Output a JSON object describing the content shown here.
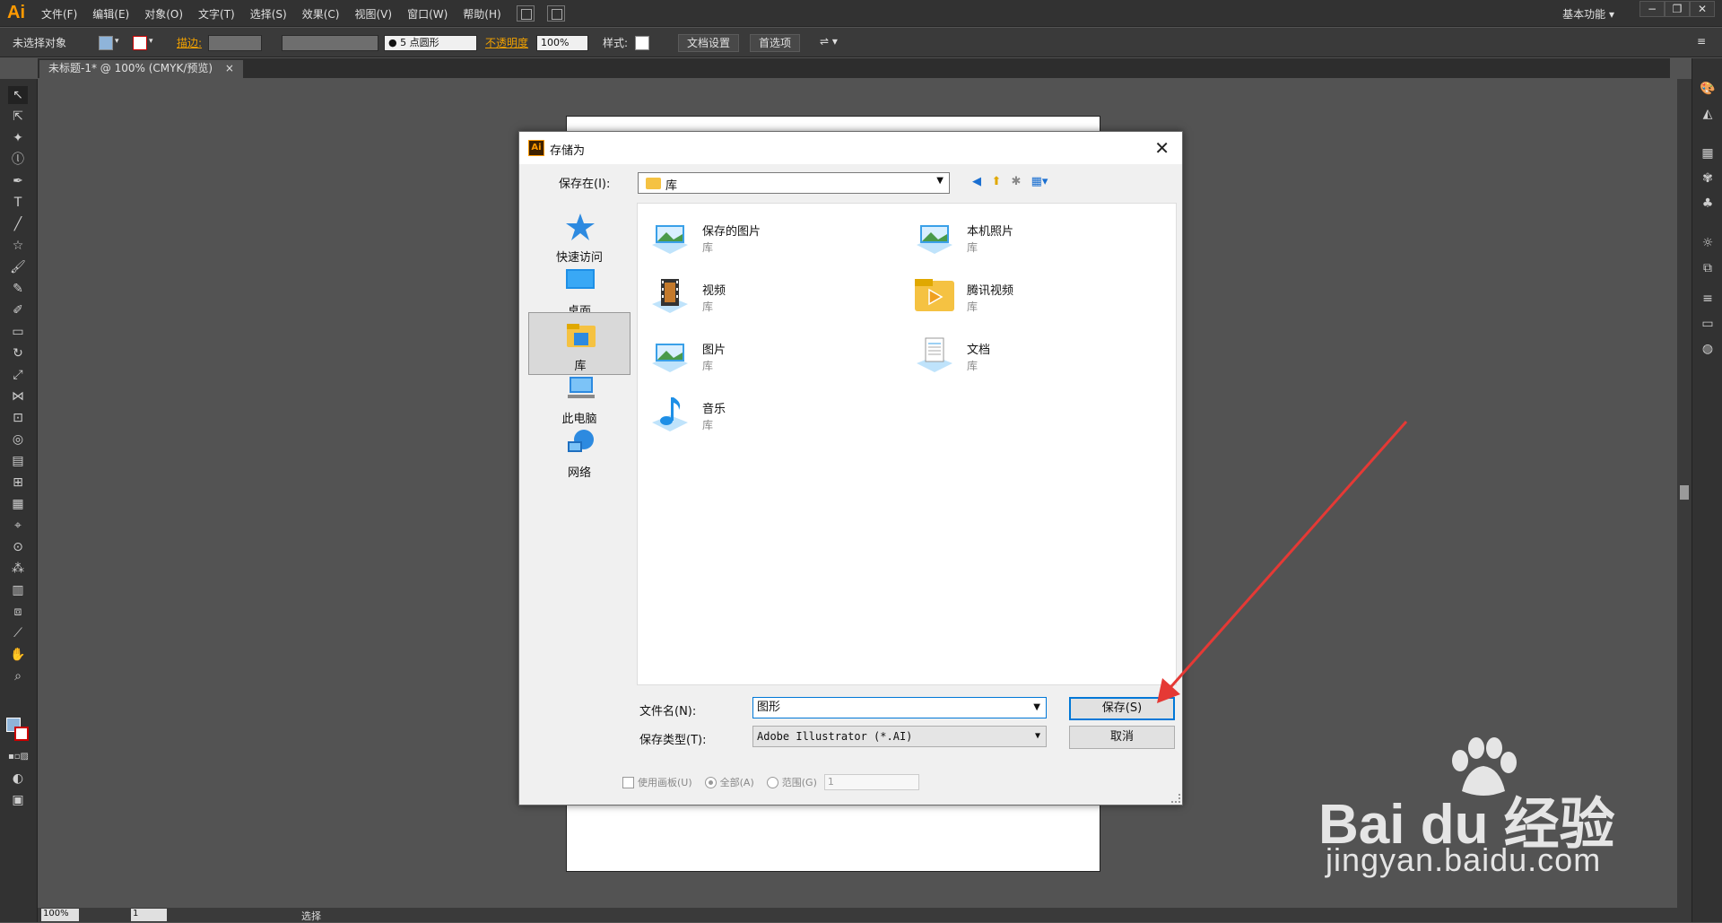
{
  "app": {
    "logo": "Ai",
    "workspace": "基本功能"
  },
  "menu": [
    "文件(F)",
    "编辑(E)",
    "对象(O)",
    "文字(T)",
    "选择(S)",
    "效果(C)",
    "视图(V)",
    "窗口(W)",
    "帮助(H)"
  ],
  "control_bar": {
    "selection": "未选择对象",
    "stroke_label": "描边:",
    "brush": "● 5 点圆形",
    "opacity_label": "不透明度",
    "opacity_value": "100%",
    "style_label": "样式:",
    "doc_setup": "文档设置",
    "prefs": "首选项"
  },
  "doc_tab": {
    "title": "未标题-1* @ 100% (CMYK/预览)",
    "close": "×"
  },
  "status": {
    "zoom": "100%",
    "page": "1",
    "mode": "选择"
  },
  "dialog": {
    "title": "存储为",
    "save_in_label": "保存在(I):",
    "save_in_value": "库",
    "places": [
      {
        "label": "快速访问",
        "icon": "star-icon"
      },
      {
        "label": "桌面",
        "icon": "desktop-icon"
      },
      {
        "label": "库",
        "icon": "library-icon",
        "selected": true
      },
      {
        "label": "此电脑",
        "icon": "computer-icon"
      },
      {
        "label": "网络",
        "icon": "network-icon"
      }
    ],
    "files": [
      {
        "name": "保存的图片",
        "sub": "库",
        "icon": "pictures-library-icon"
      },
      {
        "name": "本机照片",
        "sub": "库",
        "icon": "pictures-library-icon"
      },
      {
        "name": "视频",
        "sub": "库",
        "icon": "video-library-icon"
      },
      {
        "name": "腾讯视频",
        "sub": "库",
        "icon": "folder-video-icon"
      },
      {
        "name": "图片",
        "sub": "库",
        "icon": "pictures-library-icon"
      },
      {
        "name": "文档",
        "sub": "库",
        "icon": "documents-library-icon"
      },
      {
        "name": "音乐",
        "sub": "库",
        "icon": "music-library-icon"
      }
    ],
    "filename_label": "文件名(N):",
    "filename_value": "图形",
    "filetype_label": "保存类型(T):",
    "filetype_value": "Adobe Illustrator (*.AI)",
    "save_button": "保存(S)",
    "cancel_button": "取消",
    "opt_artboards": "使用画板(U)",
    "opt_all": "全部(A)",
    "opt_range": "范围(G)",
    "range_value": "1"
  },
  "watermark": {
    "brand": "Bai du 经验",
    "url": "jingyan.baidu.com"
  },
  "colors": {
    "accent": "#0078d7",
    "ai_orange": "#ff9a00",
    "arrow": "#e53935"
  }
}
